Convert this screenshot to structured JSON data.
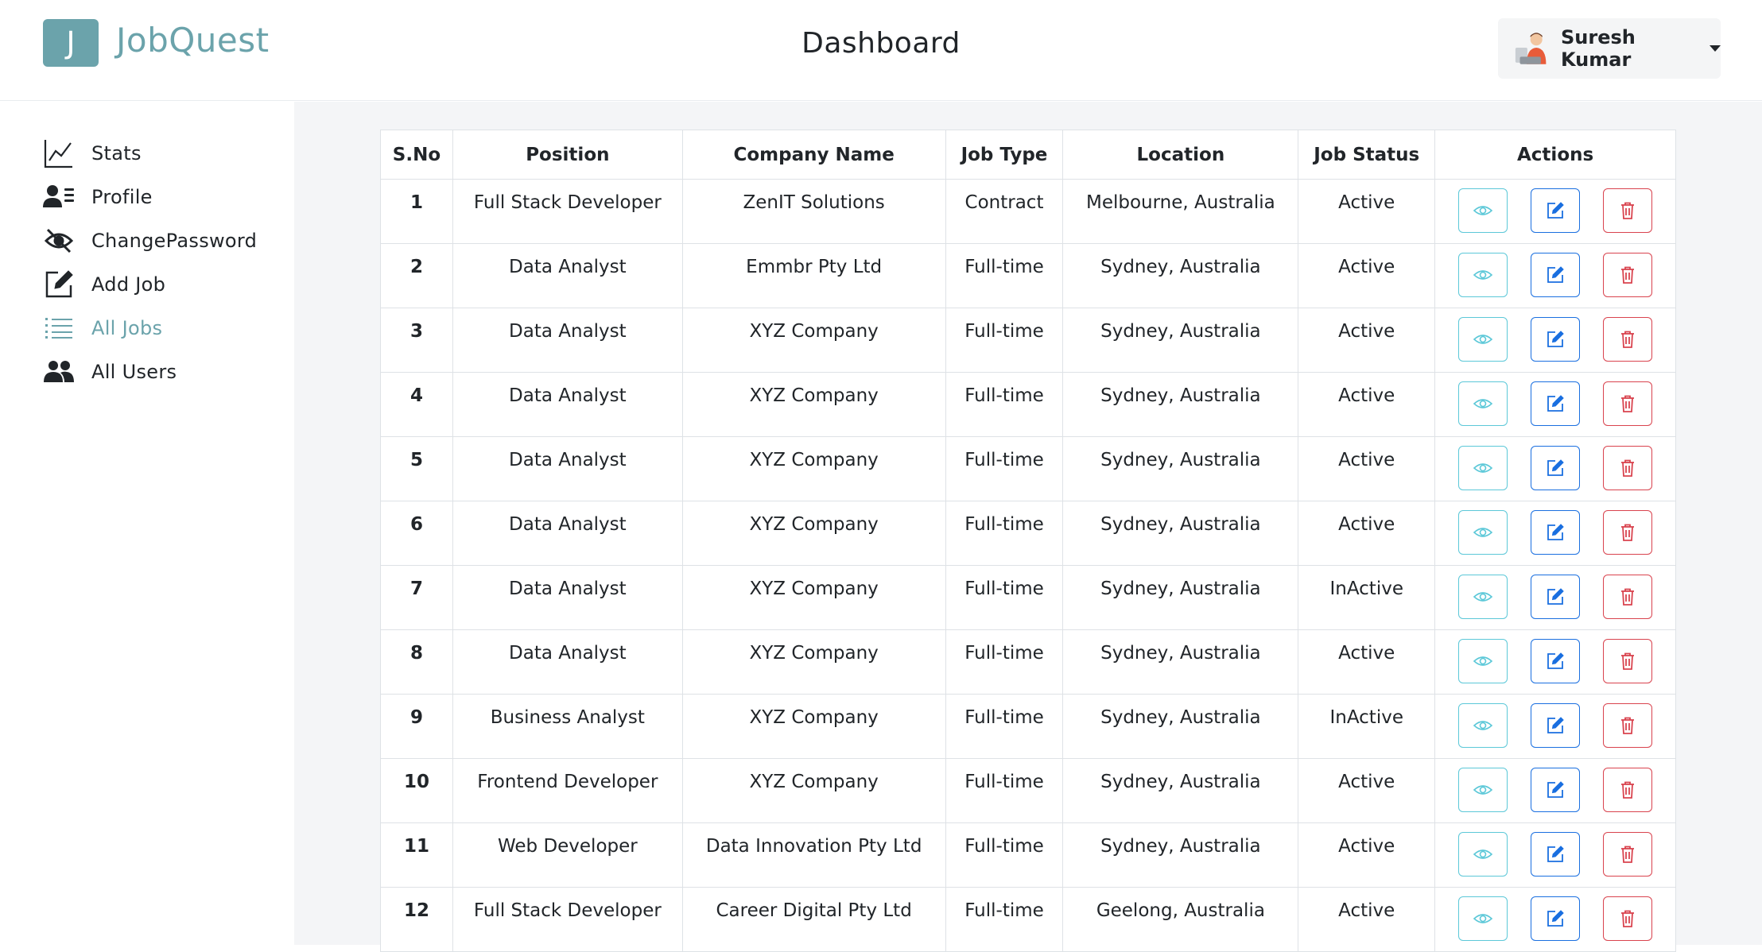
{
  "header": {
    "logo_letter": "J",
    "brand": "JobQuest",
    "title": "Dashboard",
    "user_name": "Suresh Kumar"
  },
  "colors": {
    "accent": "#6ba3ab",
    "view": "#5cc8d8",
    "edit": "#1a6fe0",
    "delete": "#d9434e"
  },
  "sidebar": {
    "items": [
      {
        "label": "Stats",
        "icon": "chart-line-icon"
      },
      {
        "label": "Profile",
        "icon": "user-details-icon"
      },
      {
        "label": "ChangePassword",
        "icon": "eye-slash-icon"
      },
      {
        "label": "Add Job",
        "icon": "edit-icon"
      },
      {
        "label": "All Jobs",
        "icon": "list-icon",
        "active": true
      },
      {
        "label": "All Users",
        "icon": "users-icon"
      }
    ]
  },
  "table": {
    "headers": [
      "S.No",
      "Position",
      "Company Name",
      "Job Type",
      "Location",
      "Job Status",
      "Actions"
    ],
    "rows": [
      {
        "sno": "1",
        "position": "Full Stack Developer",
        "company": "ZenIT Solutions",
        "type": "Contract",
        "location": "Melbourne, Australia",
        "status": "Active"
      },
      {
        "sno": "2",
        "position": "Data Analyst",
        "company": "Emmbr Pty Ltd",
        "type": "Full-time",
        "location": "Sydney, Australia",
        "status": "Active"
      },
      {
        "sno": "3",
        "position": "Data Analyst",
        "company": "XYZ Company",
        "type": "Full-time",
        "location": "Sydney, Australia",
        "status": "Active"
      },
      {
        "sno": "4",
        "position": "Data Analyst",
        "company": "XYZ Company",
        "type": "Full-time",
        "location": "Sydney, Australia",
        "status": "Active"
      },
      {
        "sno": "5",
        "position": "Data Analyst",
        "company": "XYZ Company",
        "type": "Full-time",
        "location": "Sydney, Australia",
        "status": "Active"
      },
      {
        "sno": "6",
        "position": "Data Analyst",
        "company": "XYZ Company",
        "type": "Full-time",
        "location": "Sydney, Australia",
        "status": "Active"
      },
      {
        "sno": "7",
        "position": "Data Analyst",
        "company": "XYZ Company",
        "type": "Full-time",
        "location": "Sydney, Australia",
        "status": "InActive"
      },
      {
        "sno": "8",
        "position": "Data Analyst",
        "company": "XYZ Company",
        "type": "Full-time",
        "location": "Sydney, Australia",
        "status": "Active"
      },
      {
        "sno": "9",
        "position": "Business Analyst",
        "company": "XYZ Company",
        "type": "Full-time",
        "location": "Sydney, Australia",
        "status": "InActive"
      },
      {
        "sno": "10",
        "position": "Frontend Developer",
        "company": "XYZ Company",
        "type": "Full-time",
        "location": "Sydney, Australia",
        "status": "Active"
      },
      {
        "sno": "11",
        "position": "Web Developer",
        "company": "Data Innovation Pty Ltd",
        "type": "Full-time",
        "location": "Sydney, Australia",
        "status": "Active"
      },
      {
        "sno": "12",
        "position": "Full Stack Developer",
        "company": "Career Digital Pty Ltd",
        "type": "Full-time",
        "location": "Geelong, Australia",
        "status": "Active"
      }
    ]
  }
}
